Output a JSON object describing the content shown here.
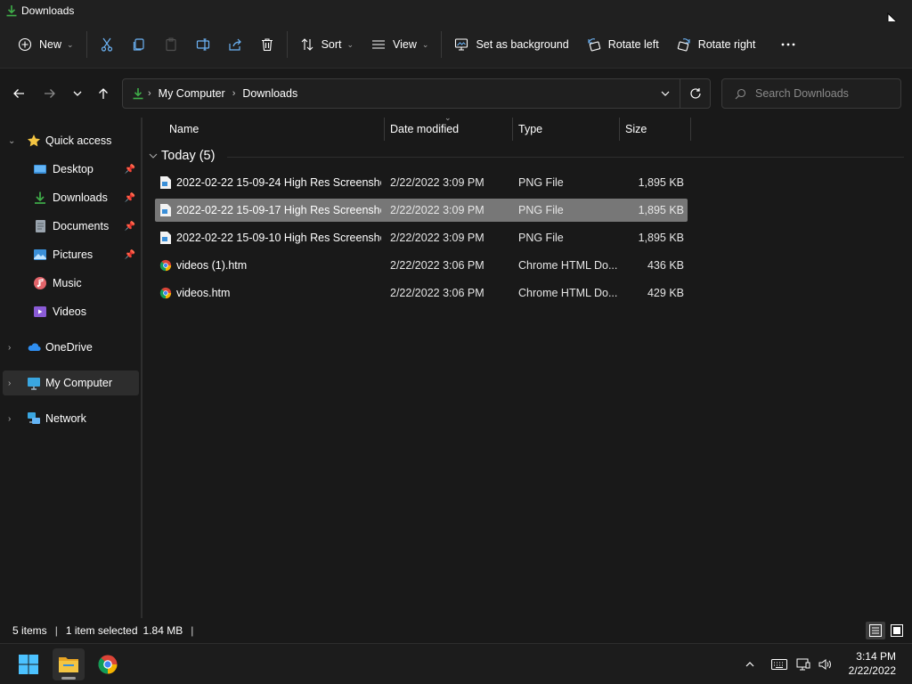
{
  "window": {
    "title": "Downloads"
  },
  "toolbar": {
    "new_label": "New",
    "sort_label": "Sort",
    "view_label": "View",
    "set_background_label": "Set as background",
    "rotate_left_label": "Rotate left",
    "rotate_right_label": "Rotate right"
  },
  "address": {
    "crumbs": [
      "My Computer",
      "Downloads"
    ],
    "search_placeholder": "Search Downloads"
  },
  "nav": {
    "quick_access": "Quick access",
    "items": [
      {
        "label": "Desktop",
        "pinned": true
      },
      {
        "label": "Downloads",
        "pinned": true
      },
      {
        "label": "Documents",
        "pinned": true
      },
      {
        "label": "Pictures",
        "pinned": true
      },
      {
        "label": "Music",
        "pinned": false
      },
      {
        "label": "Videos",
        "pinned": false
      }
    ],
    "onedrive": "OneDrive",
    "my_computer": "My Computer",
    "network": "Network"
  },
  "columns": {
    "name": "Name",
    "date": "Date modified",
    "type": "Type",
    "size": "Size"
  },
  "group": {
    "label": "Today (5)"
  },
  "files": [
    {
      "name": "2022-02-22 15-09-24 High Res Screensho...",
      "date": "2/22/2022 3:09 PM",
      "type": "PNG File",
      "size": "1,895 KB",
      "icon": "image-file-icon"
    },
    {
      "name": "2022-02-22 15-09-17 High Res Screensho...",
      "date": "2/22/2022 3:09 PM",
      "type": "PNG File",
      "size": "1,895 KB",
      "icon": "image-file-icon",
      "selected": true
    },
    {
      "name": "2022-02-22 15-09-10 High Res Screensho...",
      "date": "2/22/2022 3:09 PM",
      "type": "PNG File",
      "size": "1,895 KB",
      "icon": "image-file-icon"
    },
    {
      "name": "videos (1).htm",
      "date": "2/22/2022 3:06 PM",
      "type": "Chrome HTML Do...",
      "size": "436 KB",
      "icon": "chrome-icon"
    },
    {
      "name": "videos.htm",
      "date": "2/22/2022 3:06 PM",
      "type": "Chrome HTML Do...",
      "size": "429 KB",
      "icon": "chrome-icon"
    }
  ],
  "status": {
    "items": "5 items",
    "selected": "1 item selected",
    "selected_size": "1.84 MB"
  },
  "taskbar": {
    "time": "3:14 PM",
    "date": "2/22/2022"
  },
  "colors": {
    "accent_green": "#3fae49",
    "selection": "#777777",
    "folder_yellow": "#f4c542"
  }
}
